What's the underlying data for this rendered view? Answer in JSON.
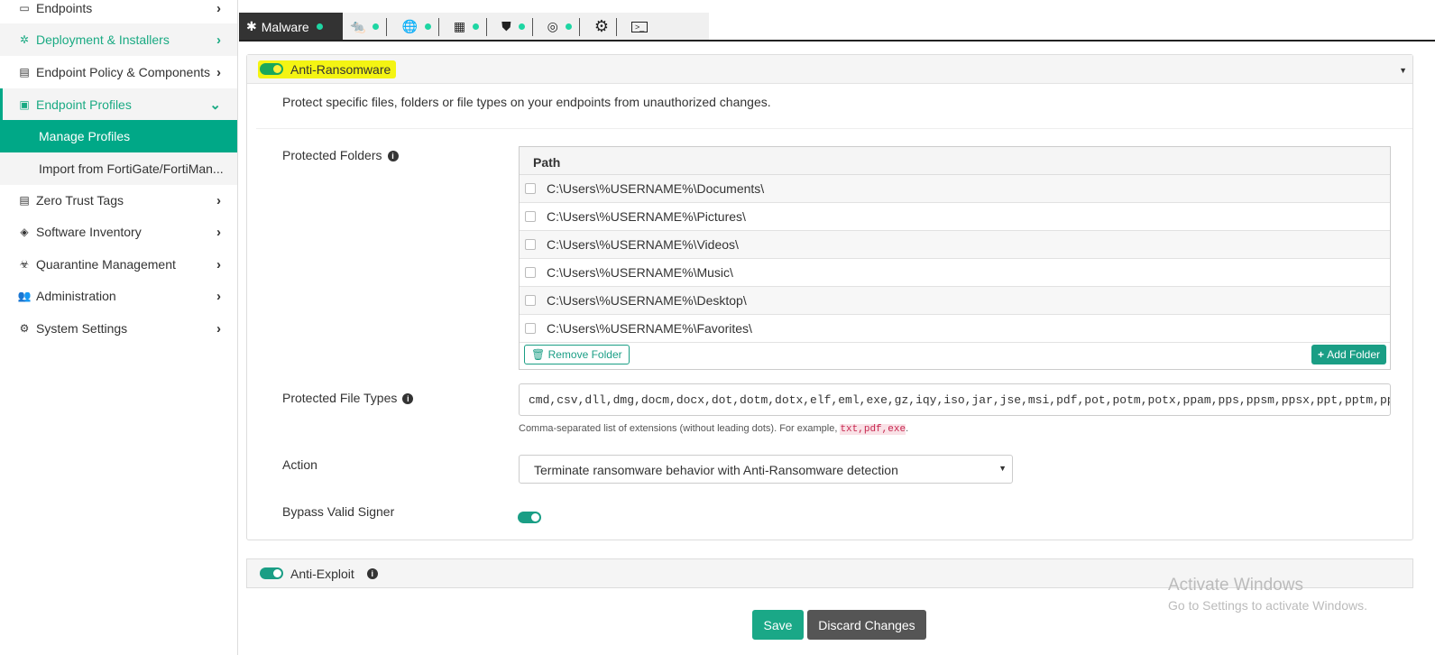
{
  "sidebar": {
    "items": [
      {
        "label": "Endpoints",
        "icon": "laptop-icon"
      },
      {
        "label": "Deployment & Installers",
        "icon": "gear-deploy-icon"
      },
      {
        "label": "Endpoint Policy & Components",
        "icon": "policy-icon"
      },
      {
        "label": "Endpoint Profiles",
        "icon": "profile-icon"
      },
      {
        "label": "Manage Profiles"
      },
      {
        "label": "Import from FortiGate/FortiMan..."
      },
      {
        "label": "Zero Trust Tags",
        "icon": "tag-icon"
      },
      {
        "label": "Software Inventory",
        "icon": "inventory-icon"
      },
      {
        "label": "Quarantine Management",
        "icon": "biohazard-icon"
      },
      {
        "label": "Administration",
        "icon": "users-icon"
      },
      {
        "label": "System Settings",
        "icon": "gear-icon"
      }
    ]
  },
  "tabs": {
    "active": "Malware"
  },
  "anti_ransomware": {
    "title": "Anti-Ransomware",
    "description": "Protect specific files, folders or file types on your endpoints from unauthorized changes.",
    "protected_folders_label": "Protected Folders",
    "path_header": "Path",
    "folders": [
      "C:\\Users\\%USERNAME%\\Documents\\",
      "C:\\Users\\%USERNAME%\\Pictures\\",
      "C:\\Users\\%USERNAME%\\Videos\\",
      "C:\\Users\\%USERNAME%\\Music\\",
      "C:\\Users\\%USERNAME%\\Desktop\\",
      "C:\\Users\\%USERNAME%\\Favorites\\"
    ],
    "remove_folder": "Remove Folder",
    "add_folder": "Add Folder",
    "file_types_label": "Protected File Types",
    "file_types_value": "cmd,csv,dll,dmg,docm,docx,dot,dotm,dotx,elf,eml,exe,gz,iqy,iso,jar,jse,msi,pdf,pot,potm,potx,ppam,pps,ppsm,ppsx,ppt,pptm,ppt",
    "hint": "Comma-separated list of extensions (without leading dots). For example, ",
    "hint_example": "txt,pdf,exe",
    "hint_end": ".",
    "action_label": "Action",
    "action_value": "Terminate ransomware behavior with Anti-Ransomware detection",
    "bypass_label": "Bypass Valid Signer"
  },
  "anti_exploit": {
    "title": "Anti-Exploit"
  },
  "buttons": {
    "save": "Save",
    "discard": "Discard Changes"
  },
  "watermark": {
    "line1": "Activate Windows",
    "line2": "Go to Settings to activate Windows."
  }
}
